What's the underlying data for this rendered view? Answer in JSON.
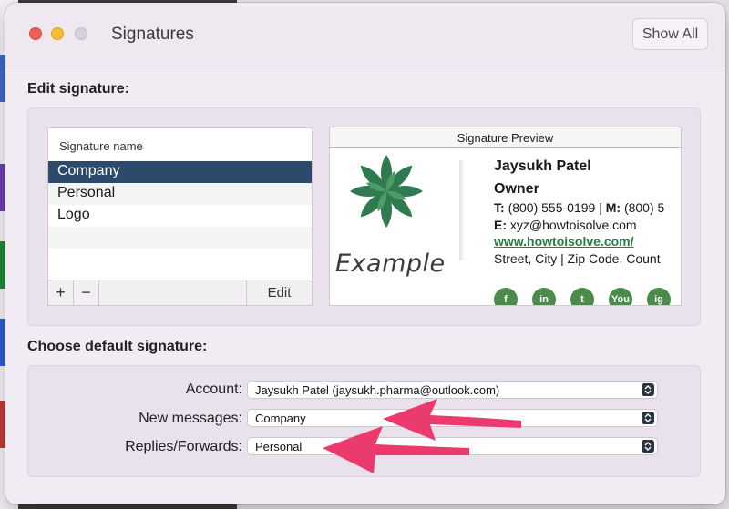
{
  "window": {
    "title": "Signatures",
    "show_all_label": "Show All"
  },
  "edit_signature": {
    "section_label": "Edit signature:",
    "list_header": "Signature name",
    "items": [
      {
        "label": "Company",
        "selected": true
      },
      {
        "label": "Personal",
        "selected": false
      },
      {
        "label": "Logo",
        "selected": false
      }
    ],
    "add_label": "+",
    "remove_label": "−",
    "edit_label": "Edit"
  },
  "preview": {
    "header": "Signature Preview",
    "logo_text": "Example",
    "name": "Jaysukh Patel",
    "role": "Owner",
    "phone_label_t": "T:",
    "phone_t": "(800) 555-0199 |",
    "phone_label_m": "M:",
    "phone_m": "(800) 5",
    "email_label": "E:",
    "email": "xyz@howtoisolve.com",
    "website": "www.howtoisolve.com/",
    "address": "Street, City | Zip Code, Count",
    "social": [
      "f",
      "in",
      "t",
      "You",
      "ig"
    ],
    "accent_color": "#2c7a45"
  },
  "default_signature": {
    "section_label": "Choose default signature:",
    "account_label": "Account:",
    "account_value": "Jaysukh Patel (jaysukh.pharma@outlook.com)",
    "new_messages_label": "New messages:",
    "new_messages_value": "Company",
    "replies_label": "Replies/Forwards:",
    "replies_value": "Personal"
  },
  "annotation": {
    "arrow_color": "#ea3a6e"
  }
}
